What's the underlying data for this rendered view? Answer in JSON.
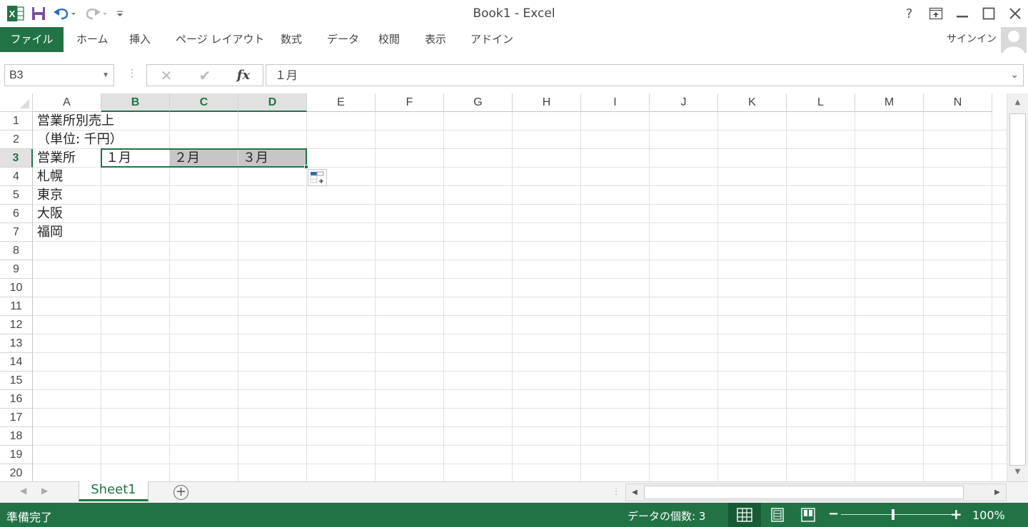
{
  "window": {
    "title": "Book1 - Excel"
  },
  "qat": {
    "icons": [
      "excel-logo-icon",
      "save-icon",
      "undo-icon",
      "redo-icon",
      "customize-qat-icon"
    ]
  },
  "window_controls": {
    "help": "?",
    "restore_ribbon": "⇱",
    "minimize": "—",
    "maximize": "☐",
    "close": "✕"
  },
  "ribbon": {
    "file_label": "ファイル",
    "tabs": [
      "ホーム",
      "挿入",
      "ページ レイアウト",
      "数式",
      "データ",
      "校閲",
      "表示",
      "アドイン"
    ],
    "signin_label": "サインイン"
  },
  "formula_bar": {
    "name_box": "B3",
    "cancel": "✕",
    "enter": "✔",
    "fx": "fx",
    "value": "１月"
  },
  "columns": [
    "A",
    "B",
    "C",
    "D",
    "E",
    "F",
    "G",
    "H",
    "I",
    "J",
    "K",
    "L",
    "M",
    "N"
  ],
  "rows": [
    "1",
    "2",
    "3",
    "4",
    "5",
    "6",
    "7",
    "8",
    "9",
    "10",
    "11",
    "12",
    "13",
    "14",
    "15",
    "16",
    "17",
    "18",
    "19",
    "20"
  ],
  "selection": {
    "active_cell": "B3",
    "range": "B3:D3",
    "selected_columns": [
      "B",
      "C",
      "D"
    ],
    "selected_row": "3"
  },
  "cells": {
    "A1": "営業所別売上",
    "A2": "（単位: 千円）",
    "A3": "営業所",
    "B3": "１月",
    "C3": "２月",
    "D3": "３月",
    "A4": "札幌",
    "A5": "東京",
    "A6": "大阪",
    "A7": "福岡"
  },
  "sheets": {
    "tabs": [
      "Sheet1"
    ],
    "active": "Sheet1",
    "add_label": "+"
  },
  "status": {
    "ready": "準備完了",
    "count": "データの個数: 3",
    "zoom": "100%",
    "zoom_minus": "−",
    "zoom_plus": "+"
  },
  "colors": {
    "accent": "#217346",
    "selection_fill": "#c6c6c6",
    "header_selected": "#e1e1e1"
  }
}
